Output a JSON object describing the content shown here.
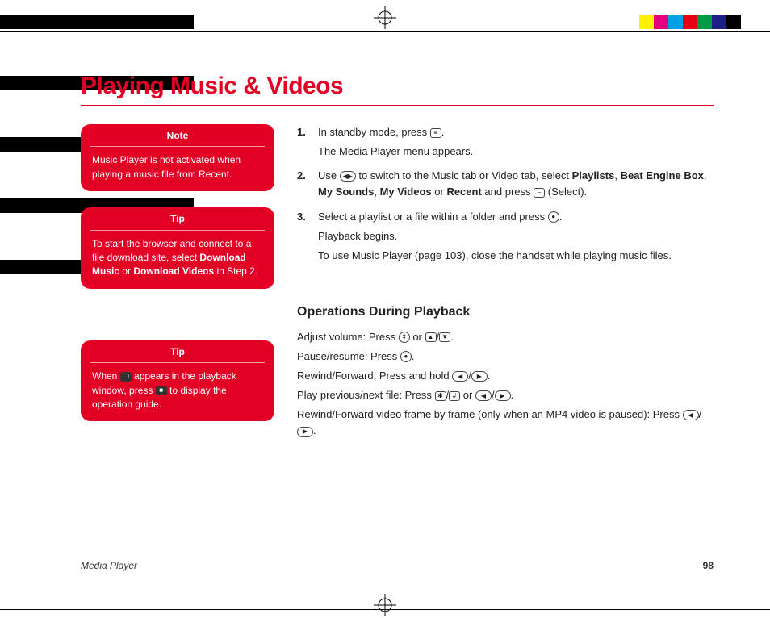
{
  "title": "Playing Music & Videos",
  "callouts": [
    {
      "header": "Note",
      "kind": "note",
      "body": "Music Player is not activated when playing a music file from Recent."
    },
    {
      "header": "Tip",
      "kind": "tip",
      "body_pre": "To start the browser and connect to a file download site, select ",
      "bold1": "Download Music",
      "mid": " or ",
      "bold2": "Download Videos",
      "body_post": " in Step 2."
    },
    {
      "header": "Tip",
      "kind": "tip",
      "body_pre": "When ",
      "icon1": "display-icon",
      "mid": " appears in the playback window, press ",
      "icon2": "media-key",
      "body_post": " to display the operation guide."
    }
  ],
  "steps": [
    {
      "text_pre": "In standby mode, press ",
      "key": "menu-key",
      "text_post": ".",
      "sub": "The Media Player menu appears."
    },
    {
      "text_pre": "Use ",
      "key": "nav-lr-key",
      "text_mid": " to switch to the Music tab or Video tab, select ",
      "bolds": [
        "Playlists",
        "Beat Engine Box",
        "My Sounds",
        "My Videos",
        "Recent"
      ],
      "text_join_last": " or ",
      "text_after_bolds": " and press ",
      "key2": "select-key",
      "text_post": " (Select)."
    },
    {
      "text_pre": "Select a playlist or a file within a folder and press ",
      "key": "center-key",
      "text_post": ".",
      "sub": "Playback begins.",
      "sub2": "To use Music Player (page 103), close the handset while playing music files."
    }
  ],
  "ops_header": "Operations During Playback",
  "ops": [
    {
      "label": "Adjust volume: Press ",
      "k1": "nav-ud-key",
      "mid": " or ",
      "k2": "side-up-key",
      "sep": "/",
      "k3": "side-down-key",
      "post": "."
    },
    {
      "label": "Pause/resume: Press ",
      "k1": "center-key",
      "post": "."
    },
    {
      "label": "Rewind/Forward: Press and hold ",
      "k1": "nav-left-key",
      "sep": "/",
      "k2": "nav-right-key",
      "post": "."
    },
    {
      "label": "Play previous/next file: Press ",
      "k1": "star-key",
      "sep": "/",
      "k2": "hash-key",
      "mid": " or ",
      "k3": "nav-left-key",
      "sep2": "/",
      "k4": "nav-right-key",
      "post": "."
    },
    {
      "label": "Rewind/Forward video frame by frame (only when an MP4 video is paused): Press ",
      "k1": "nav-left-key",
      "sep": "/",
      "k2": "nav-right-key",
      "post": "."
    }
  ],
  "footer": {
    "section": "Media Player",
    "page": "98"
  },
  "colors": {
    "accent": "#e20025",
    "bar": [
      "#000000",
      "#ffffff",
      "#000000",
      "#ffffff",
      "#000000",
      "#ffffff",
      "#000000",
      "#ffffff",
      "#000000",
      "#ffffff"
    ],
    "bar_right": [
      "#ffffff",
      "#fff200",
      "#e4007f",
      "#00a0e9",
      "#e60012",
      "#009944",
      "#1d2088",
      "#000000",
      "#ffffff",
      "#ffffff"
    ]
  },
  "icons": {
    "menu-key": "≡",
    "nav-lr-key": "◀▶",
    "select-key": "–",
    "center-key": "●",
    "nav-ud-key": "⇕",
    "side-up-key": "▲",
    "side-down-key": "▼",
    "nav-left-key": "◀",
    "nav-right-key": "▶",
    "star-key": "✱",
    "hash-key": "#",
    "display-icon": "🖵",
    "media-key": "■"
  }
}
